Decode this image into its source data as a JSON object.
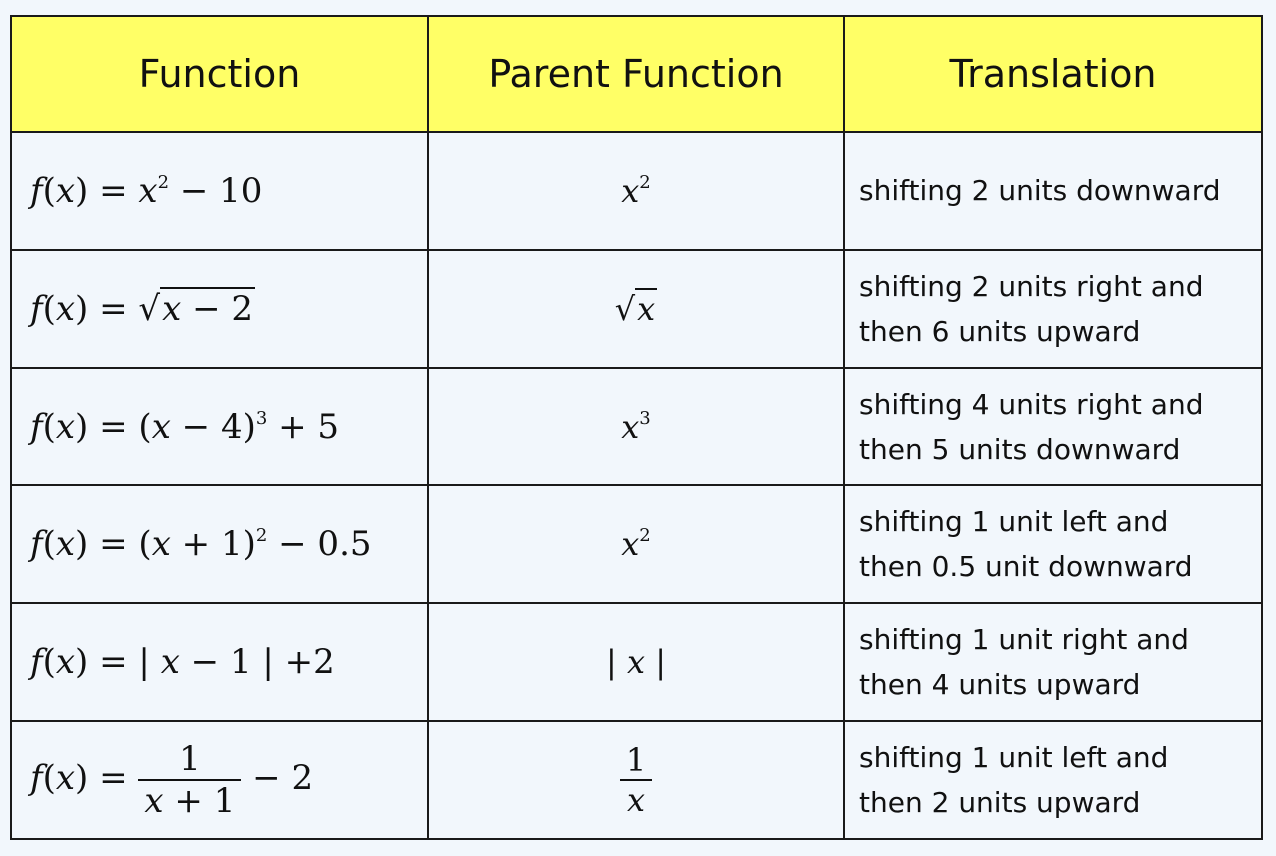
{
  "headers": [
    "Function",
    "Parent Function",
    "Translation"
  ],
  "rows": [
    {
      "function": "f(x) = x^2 − 10",
      "parent": "x^2",
      "translation": [
        "shifting 2 units downward"
      ]
    },
    {
      "function": "f(x) = √(x − 2)",
      "parent": "√x",
      "translation": [
        "shifting 2 units right and",
        "then 6 units upward"
      ]
    },
    {
      "function": "f(x) = (x − 4)^3 + 5",
      "parent": "x^3",
      "translation": [
        "shifting 4 units right and",
        "then 5 units downward"
      ]
    },
    {
      "function": "f(x) = (x + 1)^2 − 0.5",
      "parent": "x^2",
      "translation": [
        "shifting 1 unit left and",
        "then 0.5 unit downward"
      ]
    },
    {
      "function": "f(x) = | x − 1 | +2",
      "parent": "| x |",
      "translation": [
        "shifting 1 unit right and",
        "then 4 units upward"
      ]
    },
    {
      "function": "f(x) = 1/(x + 1) − 2",
      "parent": "1/x",
      "translation": [
        "shifting 1 unit left and",
        "then 2 units upward"
      ]
    }
  ]
}
